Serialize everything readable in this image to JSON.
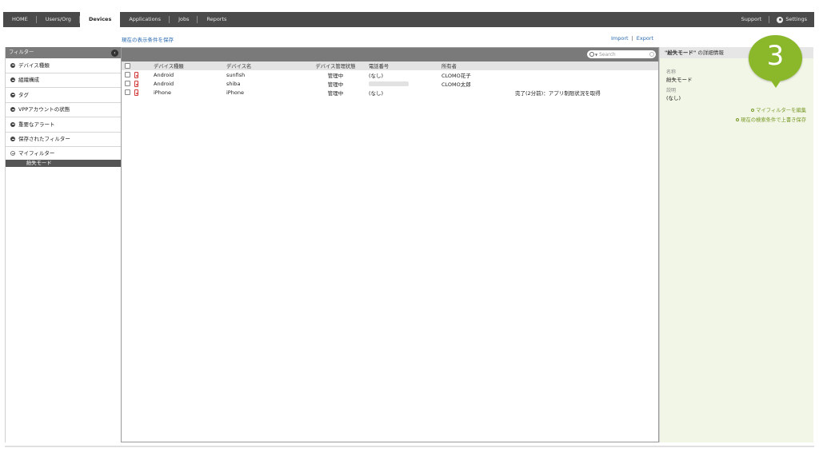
{
  "nav": {
    "items": [
      {
        "label": "HOME",
        "active": false
      },
      {
        "label": "Users/Org",
        "active": false
      },
      {
        "label": "Devices",
        "active": true
      },
      {
        "label": "Applications",
        "active": false
      },
      {
        "label": "Jobs",
        "active": false
      },
      {
        "label": "Reports",
        "active": false
      }
    ],
    "support": "Support",
    "settings": "Settings"
  },
  "toolbar": {
    "save_view": "現在の表示条件を保存",
    "import": "Import",
    "separator": "|",
    "export": "Export"
  },
  "sidebar": {
    "header": "フィルター",
    "items": [
      {
        "label": "デバイス種類"
      },
      {
        "label": "組織構成"
      },
      {
        "label": "タグ"
      },
      {
        "label": "VPPアカウントの状態"
      },
      {
        "label": "重要なアラート"
      },
      {
        "label": "保存されたフィルター"
      }
    ],
    "my_filter": "マイフィルター",
    "my_filter_selected": "紛失モード"
  },
  "search": {
    "placeholder": "Search"
  },
  "table": {
    "columns": [
      "デバイス種類",
      "デバイス名",
      "デバイス管理状態",
      "電話番号",
      "所有者",
      ""
    ],
    "rows": [
      {
        "type": "Android",
        "name": "sunfish",
        "status": "管理中",
        "phone": "(なし)",
        "owner": "CLOMO花子",
        "note": ""
      },
      {
        "type": "Android",
        "name": "shiba",
        "status": "管理中",
        "phone": "",
        "owner": "CLOMO太郎",
        "note": ""
      },
      {
        "type": "iPhone",
        "name": "iPhone",
        "status": "管理中",
        "phone": "(なし)",
        "owner": "",
        "note": "完了(2分前)：アプリ制限状況を取得"
      }
    ]
  },
  "detail": {
    "title_name": "\"紛失モード\"",
    "title_suffix": "の詳細情報",
    "name_label": "名称",
    "name_value": "紛失モード",
    "desc_label": "説明",
    "desc_value": "(なし)",
    "edit_link": "マイフィルターを編集",
    "overwrite_link": "現在の検索条件で上書き保存"
  },
  "step_badge": "3",
  "colors": {
    "nav_bg": "#4a4a4a",
    "accent_link": "#2a6ab0",
    "detail_bg": "#f2f6e6",
    "badge_green": "#8ab82a",
    "device_icon": "#d23a3a"
  }
}
